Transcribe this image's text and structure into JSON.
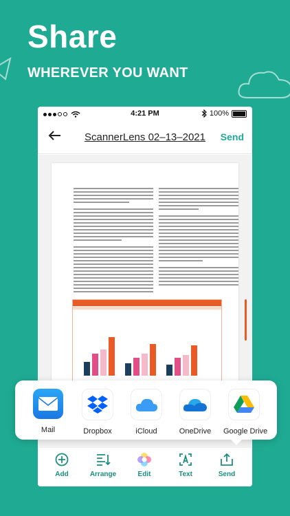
{
  "header": {
    "title": "Share",
    "subtitle": "WHEREVER YOU WANT"
  },
  "status": {
    "time": "4:21 PM",
    "battery": "100%"
  },
  "nav": {
    "title": "ScannerLens 02–13–2021",
    "send": "Send"
  },
  "share_apps": [
    {
      "label": "Mail",
      "icon": "mail-icon"
    },
    {
      "label": "Dropbox",
      "icon": "dropbox-icon"
    },
    {
      "label": "iCloud",
      "icon": "icloud-icon"
    },
    {
      "label": "OneDrive",
      "icon": "onedrive-icon"
    },
    {
      "label": "Google Drive",
      "icon": "google-drive-icon"
    }
  ],
  "toolbar": [
    {
      "label": "Add",
      "icon": "add-icon"
    },
    {
      "label": "Arrange",
      "icon": "arrange-icon"
    },
    {
      "label": "Edit",
      "icon": "edit-icon"
    },
    {
      "label": "Text",
      "icon": "text-icon"
    },
    {
      "label": "Send",
      "icon": "send-icon"
    }
  ],
  "colors": {
    "brand": "#1faa93",
    "accent": "#ea5a25"
  }
}
